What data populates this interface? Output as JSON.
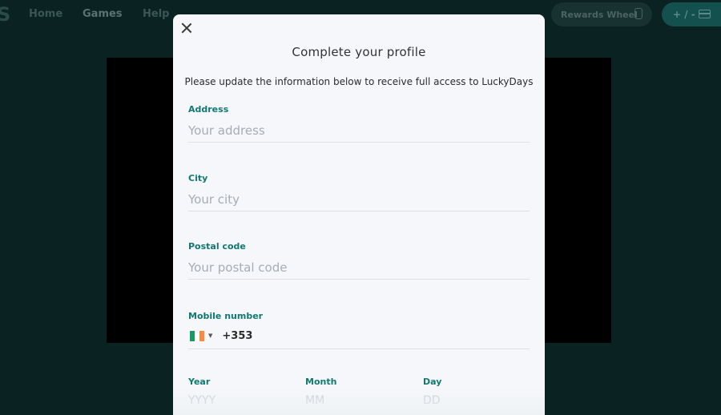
{
  "nav": {
    "logo": "S",
    "links": [
      "Home",
      "Games",
      "Help"
    ],
    "rewards_label": "Rewards Wheel",
    "wallet_label": "+ / -"
  },
  "modal": {
    "title": "Complete your profile",
    "subtitle": "Please update the information below to receive full access to LuckyDays",
    "fields": {
      "address": {
        "label": "Address",
        "placeholder": "Your address"
      },
      "city": {
        "label": "City",
        "placeholder": "Your city"
      },
      "postal": {
        "label": "Postal code",
        "placeholder": "Your postal code"
      }
    },
    "mobile": {
      "label": "Mobile number",
      "dial_code": "+353",
      "flag": "ireland-flag-icon"
    },
    "dob": {
      "year_label": "Year",
      "year_placeholder": "YYYY",
      "month_label": "Month",
      "month_placeholder": "MM",
      "day_label": "Day",
      "day_placeholder": "DD"
    }
  },
  "colors": {
    "accent": "#127872",
    "background": "#0a2322",
    "modal_bg": "#f5f7fa"
  }
}
